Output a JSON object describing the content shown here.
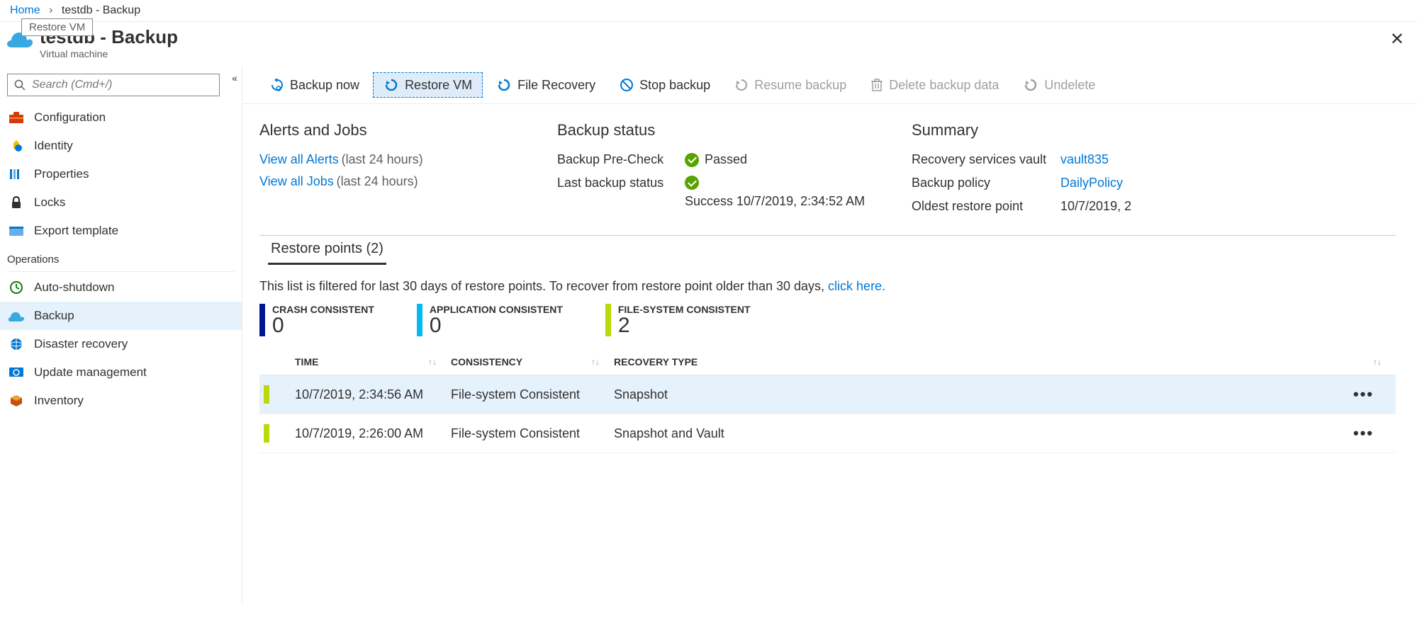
{
  "breadcrumb": {
    "home": "Home",
    "current": "testdb - Backup"
  },
  "tooltip": "Restore VM",
  "header": {
    "title": "testdb - Backup",
    "subtitle": "Virtual machine"
  },
  "search": {
    "placeholder": "Search (Cmd+/)"
  },
  "sidebar": {
    "items": [
      {
        "label": "Configuration",
        "icon": "toolbox"
      },
      {
        "label": "Identity",
        "icon": "identity"
      },
      {
        "label": "Properties",
        "icon": "properties"
      },
      {
        "label": "Locks",
        "icon": "lock"
      },
      {
        "label": "Export template",
        "icon": "export"
      }
    ],
    "section": "Operations",
    "ops": [
      {
        "label": "Auto-shutdown",
        "icon": "clock"
      },
      {
        "label": "Backup",
        "icon": "cloud",
        "selected": true
      },
      {
        "label": "Disaster recovery",
        "icon": "globe"
      },
      {
        "label": "Update management",
        "icon": "update"
      },
      {
        "label": "Inventory",
        "icon": "box"
      }
    ]
  },
  "toolbar": {
    "backup_now": "Backup now",
    "restore_vm": "Restore VM",
    "file_recovery": "File Recovery",
    "stop_backup": "Stop backup",
    "resume_backup": "Resume backup",
    "delete_backup": "Delete backup data",
    "undelete": "Undelete"
  },
  "alerts": {
    "heading": "Alerts and Jobs",
    "view_alerts": "View all Alerts",
    "view_jobs": "View all Jobs",
    "suffix": "(last 24 hours)"
  },
  "status": {
    "heading": "Backup status",
    "precheck_label": "Backup Pre-Check",
    "precheck_value": "Passed",
    "last_label": "Last backup status",
    "last_value": "Success 10/7/2019, 2:34:52 AM"
  },
  "summary": {
    "heading": "Summary",
    "vault_label": "Recovery services vault",
    "vault_value": "vault835",
    "policy_label": "Backup policy",
    "policy_value": "DailyPolicy",
    "oldest_label": "Oldest restore point",
    "oldest_value": "10/7/2019, 2"
  },
  "restore_points": {
    "tab": "Restore points (2)",
    "filter_note_prefix": "This list is filtered for last 30 days of restore points. To recover from restore point older than 30 days, ",
    "filter_note_link": "click here.",
    "stats": {
      "crash_label": "CRASH CONSISTENT",
      "crash_value": "0",
      "app_label": "APPLICATION CONSISTENT",
      "app_value": "0",
      "fs_label": "FILE-SYSTEM CONSISTENT",
      "fs_value": "2"
    },
    "columns": {
      "time": "TIME",
      "consistency": "CONSISTENCY",
      "recovery": "RECOVERY TYPE"
    },
    "rows": [
      {
        "time": "10/7/2019, 2:34:56 AM",
        "consistency": "File-system Consistent",
        "recovery": "Snapshot"
      },
      {
        "time": "10/7/2019, 2:26:00 AM",
        "consistency": "File-system Consistent",
        "recovery": "Snapshot and Vault"
      }
    ]
  }
}
